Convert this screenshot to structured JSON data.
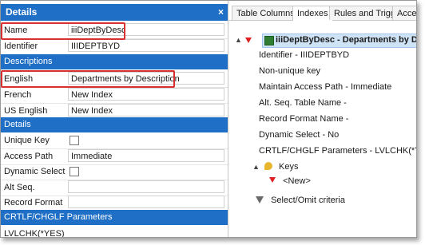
{
  "details_panel": {
    "title": "Details",
    "close_glyph": "×",
    "fields": [
      {
        "label": "Name",
        "value": "iiiDeptByDesc"
      },
      {
        "label": "Identifier",
        "value": "IIIDEPTBYD"
      }
    ],
    "descriptions_header": "Descriptions",
    "descriptions": [
      {
        "label": "English",
        "value": "Departments by Description"
      },
      {
        "label": "French",
        "value": "New Index"
      },
      {
        "label": "US English",
        "value": "New Index"
      }
    ],
    "details_header": "Details",
    "details": [
      {
        "label": "Unique Key"
      },
      {
        "label": "Access Path",
        "value": "Immediate"
      },
      {
        "label": "Dynamic Select"
      },
      {
        "label": "Alt Seq.",
        "value": ""
      },
      {
        "label": "Record Format",
        "value": ""
      }
    ],
    "crtlf_header": "CRTLF/CHGLF Parameters",
    "crtlf_value": "LVLCHK(*YES)"
  },
  "tabs": [
    "Table Columns",
    "Indexes",
    "Rules and Triggers",
    "Acce"
  ],
  "active_tab": "Indexes",
  "tree": {
    "root_label": "iiiDeptByDesc - Departments by Descripti",
    "properties": [
      "Identifier - IIIDEPTBYD",
      "Non-unique key",
      "Maintain Access Path - Immediate",
      "Alt. Seq. Table Name -",
      "Record Format Name -",
      "Dynamic Select - No",
      "CRTLF/CHGLF Parameters - LVLCHK(*YES)"
    ],
    "keys_label": "Keys",
    "new_label": "<New>",
    "select_omit_label": "Select/Omit criteria"
  },
  "colors": {
    "accent": "#1f6fc6",
    "highlight": "#d9302f",
    "selection": "#cfe3f6"
  }
}
